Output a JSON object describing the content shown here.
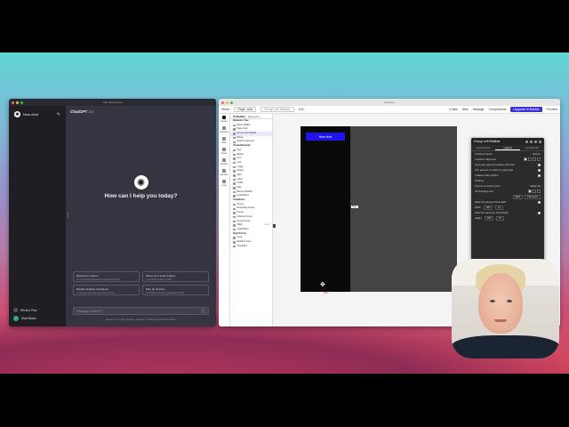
{
  "chat_window": {
    "url": "chat.openai.com",
    "new_chat_label": "New chat",
    "model_label": "ChatGPT",
    "model_version": "3.5",
    "hero_title": "How can I help you today?",
    "suggestions": [
      {
        "title": "Brainstorm names",
        "subtitle": "for my fantasy football team with a frog theme"
      },
      {
        "title": "Show me a code snippet",
        "subtitle": "of a website's sticky header"
      },
      {
        "title": "Explain airplane turbulence",
        "subtitle": "to someone who has never flown before"
      },
      {
        "title": "Plan an itinerary",
        "subtitle": "for a fashion-focused exploration of Paris"
      }
    ],
    "composer_placeholder": "Message ChatGPT...",
    "disclaimer": "ChatGPT can make mistakes. Consider checking important information.",
    "upgrade_label": "Renew Plus",
    "user_name": "Matt Blake"
  },
  "editor_window": {
    "url": "bubble.io",
    "toolbar": {
      "home": "Home",
      "page": "Page: chat",
      "element": "Group Left Sidebar",
      "zoom": "100",
      "tab_count": "0 tabs",
      "new": "New",
      "manage": "Manage",
      "components": "Components",
      "upgrade": "Upgrade to Bubble",
      "preview": "Preview"
    },
    "rail": [
      "Design",
      "Workflow",
      "Data",
      "Styles",
      "Plugins",
      "Settings",
      "Logs"
    ],
    "panel_tabs": [
      "UI Builder",
      "Elements"
    ],
    "tree": [
      {
        "label": "Elements Tree",
        "head": true
      },
      {
        "label": "Show Hidden"
      },
      {
        "label": "Page chat"
      },
      {
        "label": "Group Left Sidebar",
        "selected": true
      },
      {
        "label": "Button"
      },
      {
        "label": "Search elements"
      },
      {
        "label": "Visual Elements",
        "head": true
      },
      {
        "label": "Text"
      },
      {
        "label": "Button"
      },
      {
        "label": "Icon"
      },
      {
        "label": "Link"
      },
      {
        "label": "Image"
      },
      {
        "label": "Shape"
      },
      {
        "label": "Alert"
      },
      {
        "label": "Video"
      },
      {
        "label": "HTML"
      },
      {
        "label": "Map"
      },
      {
        "label": "Built on Bubble"
      },
      {
        "label": "Install Bone"
      },
      {
        "label": "Containers",
        "head": true
      },
      {
        "label": "Group"
      },
      {
        "label": "Repeating Group"
      },
      {
        "label": "Popup"
      },
      {
        "label": "Floating Group"
      },
      {
        "label": "Group Focus"
      },
      {
        "label": "Table",
        "badge": "BETA"
      },
      {
        "label": "Install More"
      },
      {
        "label": "Input Forms",
        "head": true
      },
      {
        "label": "Input"
      },
      {
        "label": "Multiline Input"
      },
      {
        "label": "Checkbox"
      }
    ],
    "canvas": {
      "button_label": "New chat",
      "side_tag": "Page",
      "width_tag": "Wide"
    }
  },
  "properties_panel": {
    "title": "Group Left Sidebar",
    "tabs": [
      "Appearance",
      "Layout",
      "Conditional"
    ],
    "active_tab": "Layout",
    "rows": [
      {
        "label": "Container layout",
        "value": "Column"
      },
      {
        "label": "Container alignment",
        "segments": 4
      },
      {
        "label": "Apply gap spacing between elements",
        "check": true
      },
      {
        "label": "This element is visible on page load",
        "check": true
      },
      {
        "label": "Collapse when hidden",
        "check": true
      },
      {
        "label": "Padding",
        "value": ""
      },
      {
        "label": "Fixed to container (pos)",
        "value": "Sticky top"
      },
      {
        "label": "Vertical alignment",
        "segments": 3
      },
      {
        "label": "",
        "buttons": [
          "Start",
          "Fill-center"
        ]
      },
      {
        "label": "Make this element fixed width",
        "check": true
      },
      {
        "label": "Width",
        "field": "260",
        "unit": "px"
      },
      {
        "label": "Allow the element's fixed height",
        "check": true
      },
      {
        "label": "Height",
        "field": "100",
        "unit": "%"
      }
    ]
  },
  "colors": {
    "chat_bg": "#343541",
    "chat_sidebar": "#1e1e23",
    "accent_blue": "#1f13f0",
    "upgrade_purple": "#3b2fd9"
  }
}
